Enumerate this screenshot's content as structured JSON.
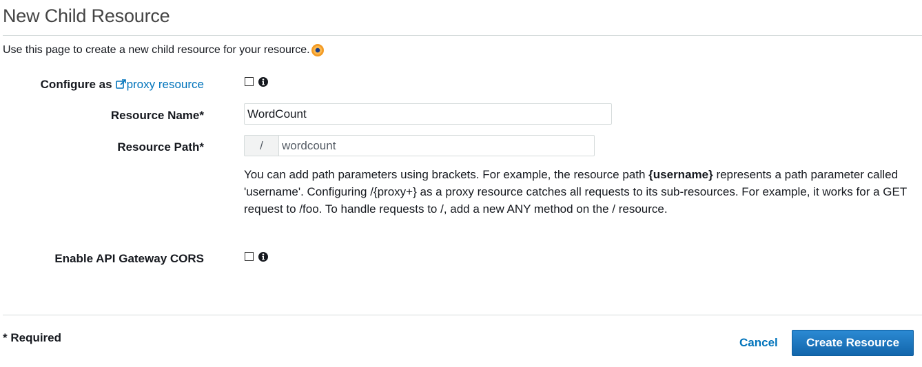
{
  "header": {
    "title": "New Child Resource"
  },
  "intro": {
    "text": "Use this page to create a new child resource for your resource."
  },
  "form": {
    "proxy": {
      "label_prefix": "Configure as",
      "link_text": "proxy resource",
      "checked": false
    },
    "resource_name": {
      "label": "Resource Name*",
      "value": "WordCount"
    },
    "resource_path": {
      "label": "Resource Path*",
      "prefix": "/",
      "value": "wordcount"
    },
    "help": {
      "before": "You can add path parameters using brackets. For example, the resource path ",
      "bold": "{username}",
      "after": " represents a path parameter called 'username'. Configuring /{proxy+} as a proxy resource catches all requests to its sub-resources. For example, it works for a GET request to /foo. To handle requests to /, add a new ANY method on the / resource."
    },
    "cors": {
      "label": "Enable API Gateway CORS",
      "checked": false
    }
  },
  "footer": {
    "required_note": "* Required",
    "cancel_label": "Cancel",
    "create_label": "Create Resource"
  },
  "colors": {
    "link": "#0073bb",
    "primary_button": "#1f78c1",
    "divider": "#d5dbdb"
  },
  "icons": {
    "intro": "info-dot-icon",
    "proxy_link": "external-link-icon",
    "field_help": "info-circle-icon"
  }
}
